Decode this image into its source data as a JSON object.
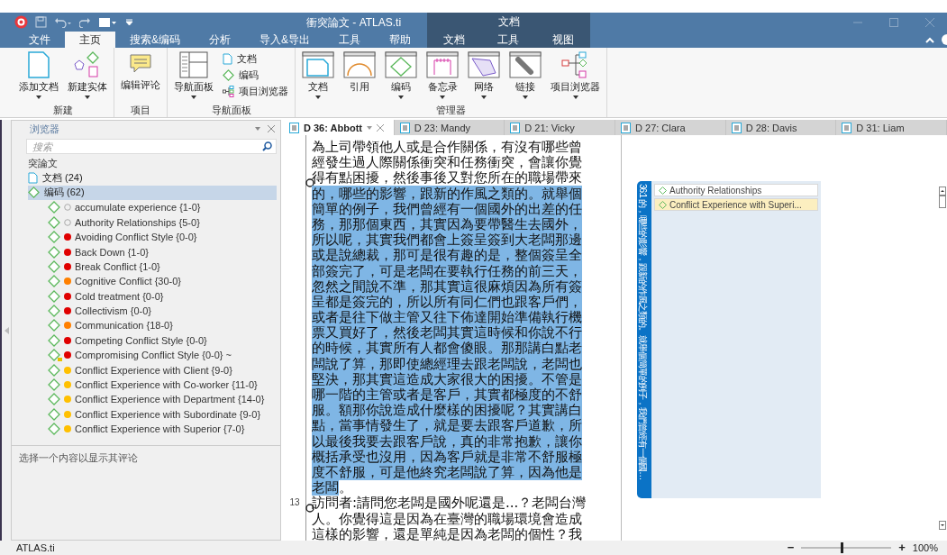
{
  "title_bar": {
    "title": "衝突論文 - ATLAS.ti",
    "context_label": "文档"
  },
  "ribbon_tabs": [
    {
      "label": "文件",
      "selected": false,
      "kind": "normal"
    },
    {
      "label": "主页",
      "selected": true,
      "kind": "normal"
    },
    {
      "label": "搜索&编码",
      "selected": false,
      "kind": "normal"
    },
    {
      "label": "分析",
      "selected": false,
      "kind": "normal"
    },
    {
      "label": "导入&导出",
      "selected": false,
      "kind": "normal"
    },
    {
      "label": "工具",
      "selected": false,
      "kind": "normal"
    },
    {
      "label": "帮助",
      "selected": false,
      "kind": "normal"
    },
    {
      "label": "文档",
      "selected": false,
      "kind": "context"
    },
    {
      "label": "工具",
      "selected": false,
      "kind": "context"
    },
    {
      "label": "视图",
      "selected": false,
      "kind": "context"
    }
  ],
  "ribbon_groups": [
    {
      "label": "新建",
      "items": [
        {
          "label": "添加文档",
          "kind": "document",
          "dropdown": true
        },
        {
          "label": "新建实体",
          "kind": "entity",
          "dropdown": true
        }
      ]
    },
    {
      "label": "项目",
      "items": [
        {
          "label": "编辑评论",
          "kind": "comment",
          "dropdown": false
        }
      ]
    },
    {
      "label": "导航面板",
      "items": [
        {
          "label": "导航面板",
          "kind": "navigator",
          "dropdown": true
        }
      ],
      "small_items": [
        {
          "label": "文档",
          "kind": "document"
        },
        {
          "label": "编码",
          "kind": "code"
        },
        {
          "label": "项目浏览器",
          "kind": "project"
        }
      ]
    },
    {
      "label": "管理器",
      "items": [
        {
          "label": "文档",
          "kind": "doc-manager",
          "dropdown": true
        },
        {
          "label": "引用",
          "kind": "quote-manager",
          "dropdown": false
        },
        {
          "label": "编码",
          "kind": "code-manager",
          "dropdown": true
        },
        {
          "label": "备忘录",
          "kind": "memo-manager",
          "dropdown": true
        },
        {
          "label": "网络",
          "kind": "network-manager",
          "dropdown": true
        },
        {
          "label": "链接",
          "kind": "link-manager",
          "dropdown": true
        },
        {
          "label": "项目浏览器",
          "kind": "project-tree",
          "dropdown": true
        }
      ]
    }
  ],
  "browser": {
    "title": "浏览器",
    "search": {
      "placeholder": "搜索"
    },
    "project": "突論文",
    "nodes": [
      {
        "label": "文档 (24)",
        "kind": "documents",
        "selected": false
      },
      {
        "label": "编码 (62)",
        "kind": "codes",
        "selected": true
      }
    ],
    "codes": [
      {
        "label": "accumulate experience {1-0}",
        "has_comment": false
      },
      {
        "label": "Authority Relationships {5-0}",
        "has_comment": false
      },
      {
        "label": "Avoiding Conflict Style {0-0}",
        "color": "#e00000",
        "has_comment": false
      },
      {
        "label": "Back Down {1-0}",
        "color": "#e00000",
        "has_comment": false
      },
      {
        "label": "Break Conflict {1-0}",
        "color": "#e00000",
        "has_comment": false
      },
      {
        "label": "Cognitive Conflict {30-0}",
        "color": "#ff8000",
        "has_comment": false
      },
      {
        "label": "Cold treatment {0-0}",
        "color": "#e00000",
        "has_comment": false
      },
      {
        "label": "Collectivism {0-0}",
        "color": "#e00000",
        "has_comment": false
      },
      {
        "label": "Communication {18-0}",
        "color": "#ff8000",
        "has_comment": false
      },
      {
        "label": "Competing Conflict Style {0-0}",
        "color": "#e00000",
        "has_comment": false
      },
      {
        "label": "Compromising Conflict Style {0-0} ~",
        "color": "#e00000",
        "has_comment": true
      },
      {
        "label": "Conflict Experience with Client {9-0}",
        "color": "#ffc000",
        "has_comment": false
      },
      {
        "label": "Conflict Experience with Co-worker {11-0}",
        "color": "#ffc000",
        "has_comment": false
      },
      {
        "label": "Conflict Experience with Department {14-0}",
        "color": "#ffc000",
        "has_comment": false
      },
      {
        "label": "Conflict Experience with Subordinate {9-0}",
        "color": "#ffc000",
        "has_comment": false
      },
      {
        "label": "Conflict Experience with Superior {7-0}",
        "color": "#ffc000",
        "has_comment": false
      }
    ],
    "comment_hint": "选择一个内容以显示其评论"
  },
  "doc_tabs": [
    {
      "label": "D 36: Abbott",
      "selected": true
    },
    {
      "label": "D 23: Mandy",
      "selected": false
    },
    {
      "label": "D 21: Vicky",
      "selected": false
    },
    {
      "label": "D 27: Clara",
      "selected": false
    },
    {
      "label": "D 28: Davis",
      "selected": false
    },
    {
      "label": "D 31: Liam",
      "selected": false
    }
  ],
  "document": {
    "lines": [
      {
        "segments": [
          {
            "text": "為上司帶領他人或是合作關係，有沒有哪些曾",
            "highlighted": false
          }
        ]
      },
      {
        "segments": [
          {
            "text": "經發生過人際關係衝突和任務衝突，會讓你覺",
            "highlighted": false
          }
        ]
      },
      {
        "segments": [
          {
            "text": "得有點困擾，然後事後又對您所在的職場帶來",
            "highlighted": false
          }
        ],
        "anchor": true
      },
      {
        "segments": [
          {
            "text": "的，哪些的影響，跟新的作風之類的。就舉個",
            "highlighted": true
          }
        ]
      },
      {
        "segments": [
          {
            "text": "簡單的例子，我們曾經有一個國外的出差的任",
            "highlighted": true
          }
        ]
      },
      {
        "segments": [
          {
            "text": "務，那那個東西，其實因為要帶醫生去國外，",
            "highlighted": true
          }
        ]
      },
      {
        "segments": [
          {
            "text": "所以呢，其實我們都會上簽呈簽到大老闆那邊",
            "highlighted": true
          }
        ]
      },
      {
        "segments": [
          {
            "text": "或是說總裁，那可是很有趣的是，整個簽呈全",
            "highlighted": true
          }
        ]
      },
      {
        "segments": [
          {
            "text": "部簽完了，可是老闆在要執行任務的前三天，",
            "highlighted": true
          }
        ]
      },
      {
        "segments": [
          {
            "text": "忽然之間說不準，那其實這很麻煩因為所有簽",
            "highlighted": true
          }
        ]
      },
      {
        "segments": [
          {
            "text": "呈都是簽完的，所以所有同仁們也跟客戶們，",
            "highlighted": true
          }
        ]
      },
      {
        "segments": [
          {
            "text": "或者是往下做主管又往下佈達開始準備執行機",
            "highlighted": true
          }
        ]
      },
      {
        "segments": [
          {
            "text": "票又買好了，然後老闆其實這時候和你說不行",
            "highlighted": true
          }
        ]
      },
      {
        "segments": [
          {
            "text": "的時候，其實所有人都會傻眼。那那講白點老",
            "highlighted": true
          }
        ]
      },
      {
        "segments": [
          {
            "text": "闆說了算，那即使總經理去跟老闆說，老闆也",
            "highlighted": true
          }
        ]
      },
      {
        "segments": [
          {
            "text": "堅決，那其實這造成大家很大的困擾。不管是",
            "highlighted": true
          }
        ]
      },
      {
        "segments": [
          {
            "text": "哪一階的主管或者是客戶，其實都極度的不舒",
            "highlighted": true
          }
        ]
      },
      {
        "segments": [
          {
            "text": "服。額那你說造成什麼樣的困擾呢？其實講白",
            "highlighted": true
          }
        ]
      },
      {
        "segments": [
          {
            "text": "點，當事情發生了，就是要去跟客戶道歉，所",
            "highlighted": true
          }
        ]
      },
      {
        "segments": [
          {
            "text": "以最後我要去跟客戶說，真的非常抱歉，讓你",
            "highlighted": true
          }
        ]
      },
      {
        "segments": [
          {
            "text": "概括承受也沒用，因為客戶就是非常不舒服極",
            "highlighted": true
          }
        ]
      },
      {
        "segments": [
          {
            "text": "度不舒服，可是他終究老闆說了算，因為他是",
            "highlighted": true
          }
        ]
      },
      {
        "segments": [
          {
            "text": "老闆",
            "highlighted": true
          },
          {
            "text": "。",
            "highlighted": false
          }
        ]
      },
      {
        "number": "13",
        "segments": [
          {
            "text": "訪問者:請問您老闆是國外呢還是...？老闆台灣",
            "highlighted": false
          }
        ],
        "anchor": true
      },
      {
        "segments": [
          {
            "text": "人。你覺得這是因為在臺灣的職場環境會造成",
            "highlighted": false
          }
        ]
      },
      {
        "segments": [
          {
            "text": "這樣的影響，還是單純是因為老闆的個性？我",
            "highlighted": false
          }
        ]
      }
    ]
  },
  "margin": {
    "quote_label": "36:1 的，哪些的影響，跟新的作風之類的。就舉個簡單的例子，我們曾經有一個國…",
    "codes": [
      {
        "label": "Authority Relationships",
        "selected": false
      },
      {
        "label": "Conflict Experience with Superi...",
        "selected": true
      }
    ]
  },
  "status_bar": {
    "app": "ATLAS.ti",
    "zoom": {
      "minus": "−",
      "plus": "+",
      "level": 0.45,
      "reading": "100%"
    }
  }
}
